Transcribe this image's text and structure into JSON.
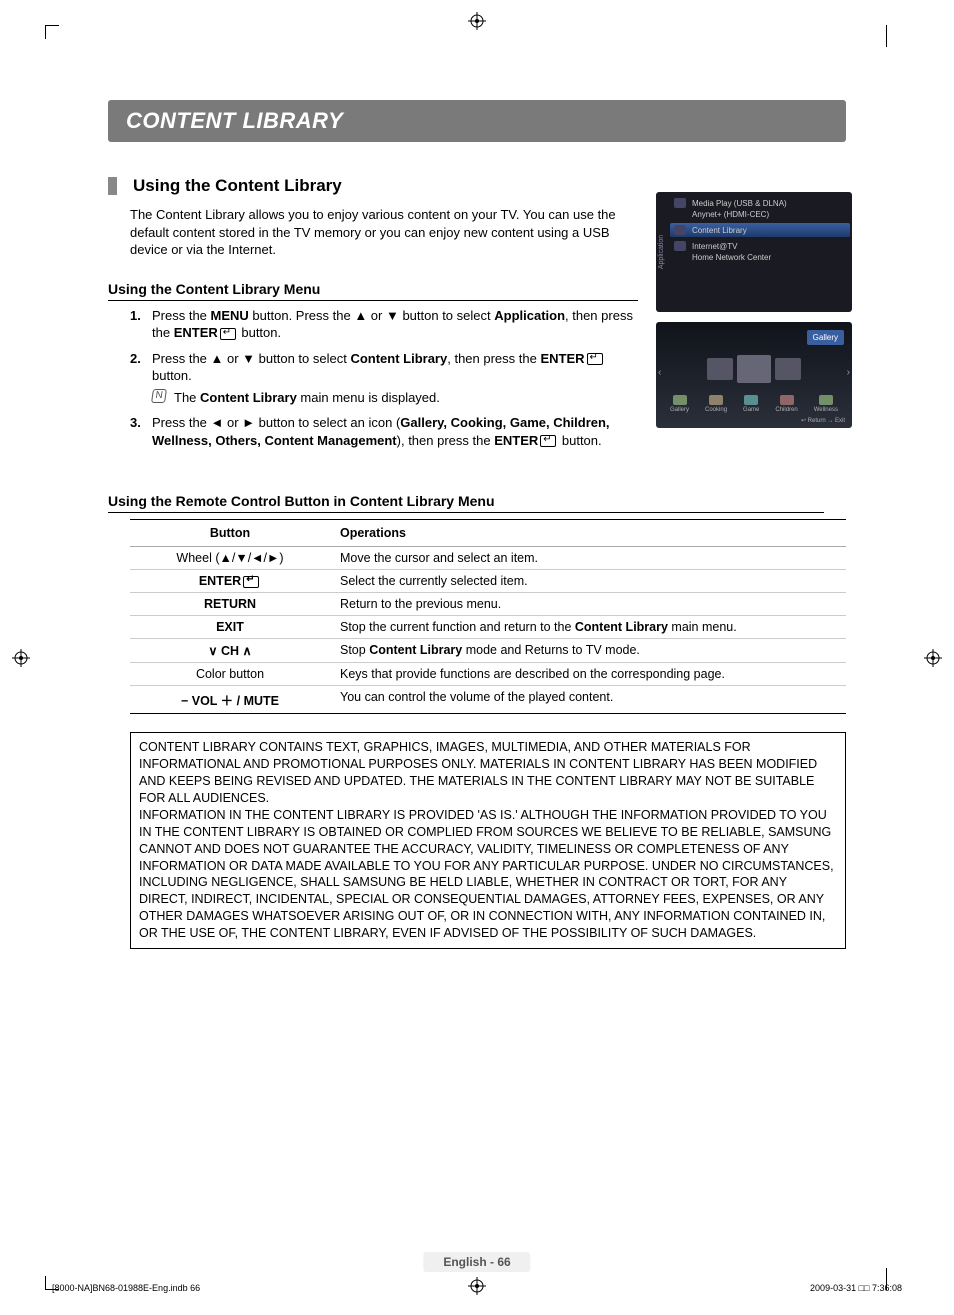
{
  "title": "CONTENT LIBRARY",
  "section_heading": "Using the Content Library",
  "intro": "The Content Library allows you to enjoy various content on your TV. You can use the default content stored in the TV memory or you can enjoy new content using a USB device or via the Internet.",
  "sub1": "Using the Content Library Menu",
  "steps": [
    {
      "num": "1.",
      "pre": "Press the ",
      "b1": "MENU",
      "mid1": " button. Press the ▲ or ▼ button to select ",
      "b2": "Application",
      "mid2": ", then press the ",
      "b3": "ENTER",
      "post": " button.",
      "note": null
    },
    {
      "num": "2.",
      "pre": "Press the ▲ or ▼ button to select ",
      "b1": "Content Library",
      "mid1": ", then press the ",
      "b2": "ENTER",
      "mid2": "",
      "b3": "",
      "post": " button.",
      "note_pre": "The ",
      "note_b": "Content Library",
      "note_post": " main menu is displayed."
    },
    {
      "num": "3.",
      "pre": "Press the ◄ or ► button to select an icon (",
      "b1": "Gallery, Cooking, Game, Children, Wellness, Others, Content Management",
      "mid1": "), then press the ",
      "b2": "ENTER",
      "mid2": "",
      "b3": "",
      "post": " button.",
      "note": null
    }
  ],
  "sub2": "Using the Remote Control Button in Content Library Menu",
  "table": {
    "head": [
      "Button",
      "Operations"
    ],
    "rows": [
      {
        "c1": "Wheel (▲/▼/◄/►)",
        "c2": "Move the cursor and select an item.",
        "c1_html": "plain"
      },
      {
        "c1": "ENTER",
        "c2": "Select the currently selected item.",
        "c1_html": "enter"
      },
      {
        "c1": "RETURN",
        "c2": "Return to the previous menu.",
        "c1_html": "plain"
      },
      {
        "c1": "EXIT",
        "c2_pre": "Stop the current function and return to the ",
        "c2_b": "Content Library",
        "c2_post": " main menu.",
        "c1_html": "plain"
      },
      {
        "c1": "∨ CH ∧",
        "c2_pre": "Stop ",
        "c2_b": "Content Library",
        "c2_post": " mode and Returns to TV mode.",
        "c1_html": "plain"
      },
      {
        "c1": "Color button",
        "c2": "Keys that provide functions are described on the corresponding page.",
        "c1_html": "plainnb"
      },
      {
        "c1": "− VOL ＋ / MUTE",
        "c2": "You can control the volume of the played content.",
        "c1_html": "plain"
      }
    ]
  },
  "disclaimer": "CONTENT LIBRARY CONTAINS TEXT, GRAPHICS, IMAGES, MULTIMEDIA, AND OTHER MATERIALS FOR INFORMATIONAL AND PROMOTIONAL PURPOSES ONLY. MATERIALS IN CONTENT LIBRARY HAS BEEN MODIFIED AND KEEPS BEING REVISED AND UPDATED. THE MATERIALS IN THE CONTENT LIBRARY MAY NOT BE SUITABLE FOR ALL AUDIENCES.\nINFORMATION IN THE CONTENT LIBRARY IS PROVIDED 'AS IS.' ALTHOUGH THE INFORMATION PROVIDED TO YOU IN THE CONTENT LIBRARY IS OBTAINED OR COMPLIED FROM SOURCES WE BELIEVE TO BE RELIABLE, SAMSUNG CANNOT AND DOES NOT GUARANTEE THE ACCURACY, VALIDITY, TIMELINESS OR COMPLETENESS OF ANY INFORMATION OR DATA MADE AVAILABLE TO YOU FOR ANY PARTICULAR PURPOSE. UNDER NO CIRCUMSTANCES, INCLUDING NEGLIGENCE, SHALL SAMSUNG BE HELD LIABLE, WHETHER IN CONTRACT OR TORT, FOR ANY DIRECT, INDIRECT, INCIDENTAL, SPECIAL OR CONSEQUENTIAL DAMAGES, ATTORNEY FEES, EXPENSES, OR ANY OTHER DAMAGES WHATSOEVER ARISING OUT OF, OR IN CONNECTION WITH, ANY INFORMATION CONTAINED IN, OR THE USE OF, THE CONTENT LIBRARY, EVEN IF ADVISED OF THE POSSIBILITY OF SUCH DAMAGES.",
  "screenshot1": {
    "side": "Application",
    "items": [
      "Media Play (USB & DLNA)",
      "Anynet+ (HDMI-CEC)",
      "Content Library",
      "Internet@TV",
      "Home Network Center"
    ]
  },
  "screenshot2": {
    "tag": "Gallery",
    "icons": [
      "Gallery",
      "Cooking",
      "Game",
      "Children",
      "Wellness"
    ],
    "hint": "↩ Return   → Exit"
  },
  "footer": "English - 66",
  "imprint_left": "[8000-NA]BN68-01988E-Eng.indb   66",
  "imprint_right": "2009-03-31   □□ 7:36:08"
}
